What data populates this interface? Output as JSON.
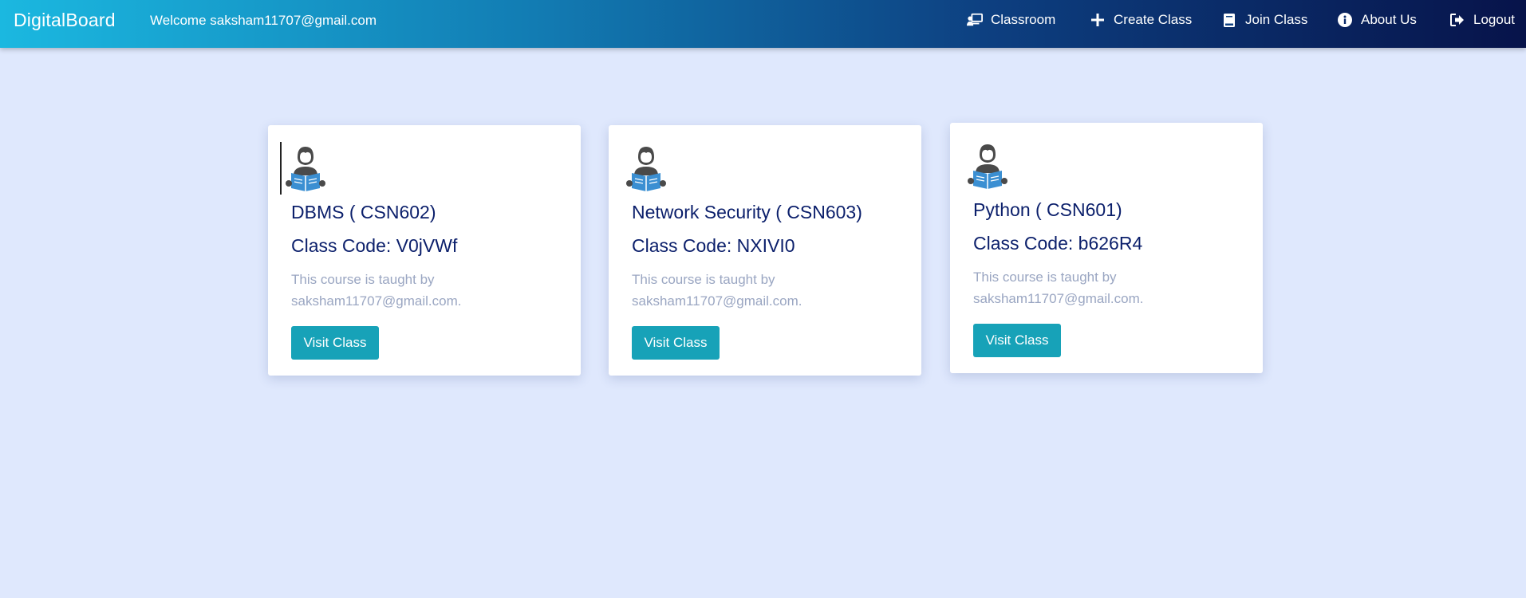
{
  "navbar": {
    "brand": "DigitalBoard",
    "welcome": "Welcome saksham11707@gmail.com",
    "items": [
      {
        "label": "Classroom",
        "icon": "classroom-icon"
      },
      {
        "label": "Create Class",
        "icon": "plus-icon"
      },
      {
        "label": "Join Class",
        "icon": "book-icon"
      },
      {
        "label": "About Us",
        "icon": "info-icon"
      },
      {
        "label": "Logout",
        "icon": "logout-icon"
      }
    ]
  },
  "cards": [
    {
      "title": "DBMS ( CSN602)",
      "code": "Class Code: V0jVWf",
      "description": "This course is taught by saksham11707@gmail.com.",
      "button": "Visit Class"
    },
    {
      "title": "Network Security ( CSN603)",
      "code": "Class Code: NXIVI0",
      "description": "This course is taught by saksham11707@gmail.com.",
      "button": "Visit Class"
    },
    {
      "title": "Python ( CSN601)",
      "code": "Class Code: b626R4",
      "description": "This course is taught by saksham11707@gmail.com.",
      "button": "Visit Class"
    }
  ],
  "colors": {
    "background": "#dfe8fd",
    "title": "#0b1f6b",
    "button": "#17a2b8",
    "muted_text": "#9aa6c2"
  }
}
